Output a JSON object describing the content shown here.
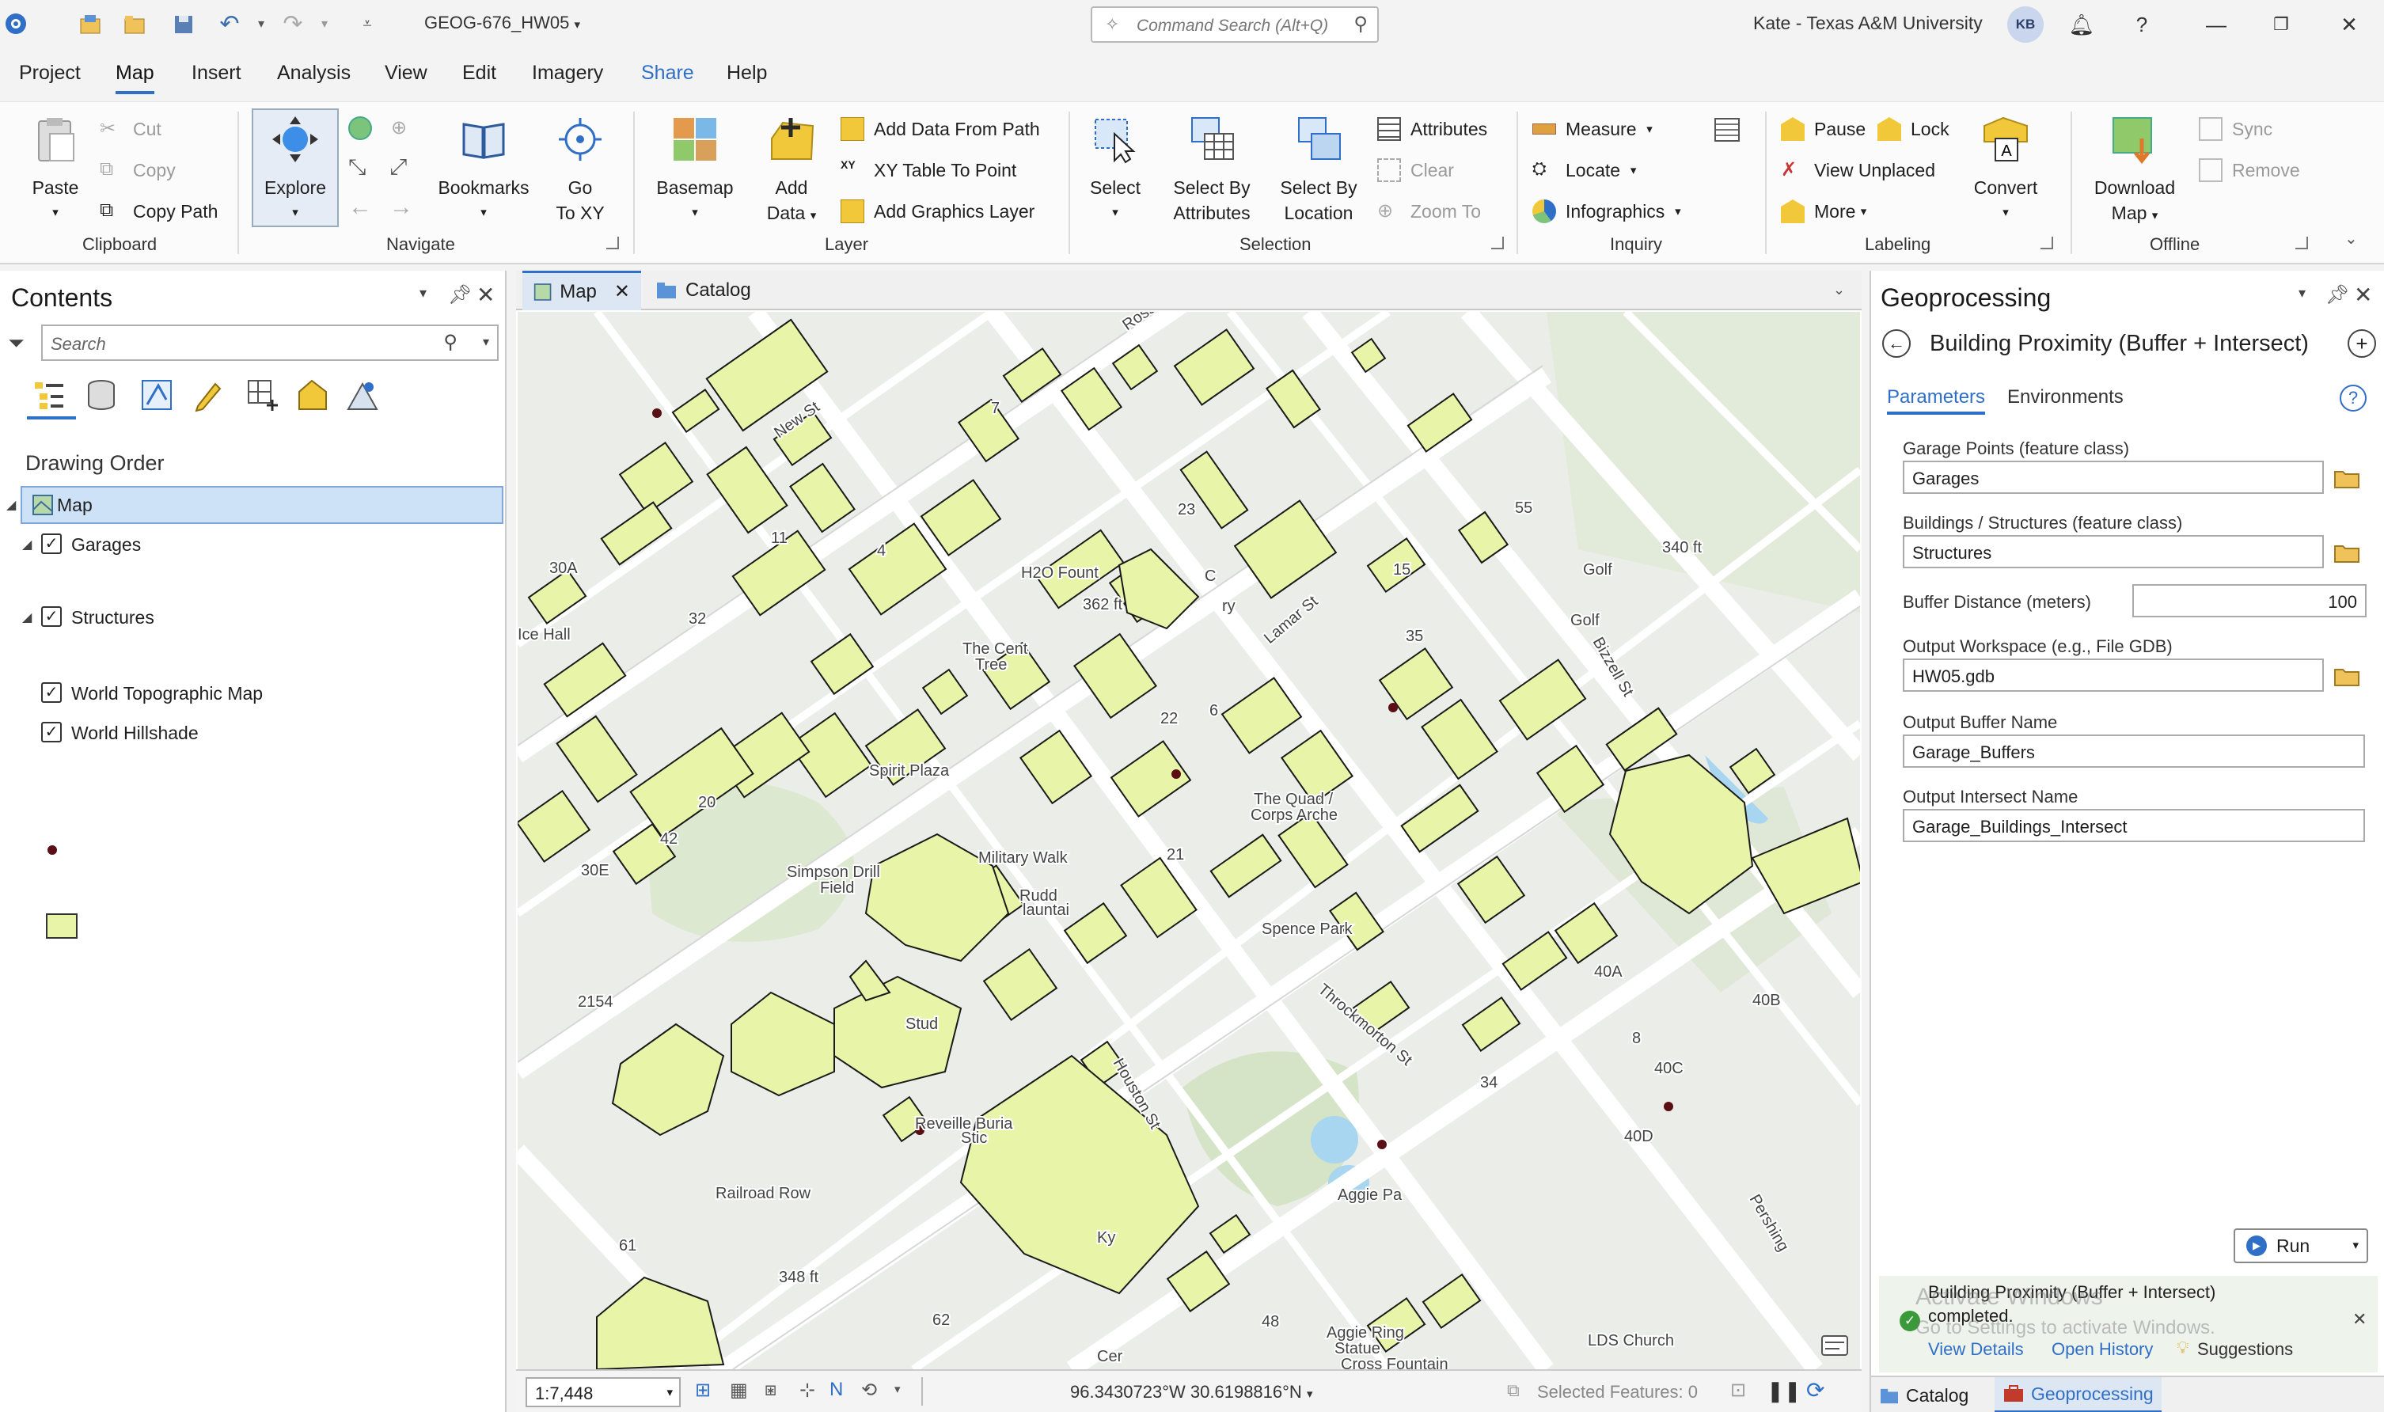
{
  "titlebar": {
    "project_title": "GEOG-676_HW05",
    "search_placeholder": "Command Search (Alt+Q)",
    "user": "Kate - Texas A&M University",
    "initials": "KB",
    "help": "?"
  },
  "menu": {
    "tabs": [
      "Project",
      "Map",
      "Insert",
      "Analysis",
      "View",
      "Edit",
      "Imagery",
      "Share",
      "Help"
    ],
    "active": "Map"
  },
  "ribbon": {
    "clipboard": {
      "label": "Clipboard",
      "paste": "Paste",
      "cut": "Cut",
      "copy": "Copy",
      "copy_path": "Copy Path"
    },
    "navigate": {
      "label": "Navigate",
      "explore": "Explore",
      "bookmarks": "Bookmarks",
      "go_to_xy_1": "Go",
      "go_to_xy_2": "To XY"
    },
    "layer": {
      "label": "Layer",
      "basemap": "Basemap",
      "add_data_1": "Add",
      "add_data_2": "Data",
      "add_from_path": "Add Data From Path",
      "xy_table": "XY Table To Point",
      "add_graphics": "Add Graphics Layer"
    },
    "selection": {
      "label": "Selection",
      "select": "Select",
      "by_attr_1": "Select By",
      "by_attr_2": "Attributes",
      "by_loc_1": "Select By",
      "by_loc_2": "Location",
      "attributes": "Attributes",
      "clear": "Clear",
      "zoom_to": "Zoom To"
    },
    "inquiry": {
      "label": "Inquiry",
      "measure": "Measure",
      "locate": "Locate",
      "infographics": "Infographics"
    },
    "labeling": {
      "label": "Labeling",
      "pause": "Pause",
      "lock": "Lock",
      "view_unplaced": "View Unplaced",
      "more": "More",
      "convert": "Convert"
    },
    "offline": {
      "label": "Offline",
      "download_1": "Download",
      "download_2": "Map",
      "sync": "Sync",
      "remove": "Remove"
    }
  },
  "contents": {
    "title": "Contents",
    "search_placeholder": "Search",
    "drawing_order": "Drawing Order",
    "map": "Map",
    "layers": [
      {
        "name": "Garages",
        "checked": true
      },
      {
        "name": "Structures",
        "checked": true
      },
      {
        "name": "World Topographic Map",
        "checked": true
      },
      {
        "name": "World Hillshade",
        "checked": true
      }
    ]
  },
  "mapview": {
    "tabs": [
      "Map",
      "Catalog"
    ],
    "scale": "1:7,448",
    "coordinates": "96.3430723°W 30.6198816°N",
    "selected_features": "Selected Features: 0",
    "labels": [
      "New St",
      "H2O Fount",
      "11",
      "4",
      "23",
      "30A",
      "55",
      "15",
      "340 ft",
      "32",
      "362 ft",
      "C",
      "Golf",
      "ry",
      "35",
      "Lamar St",
      "The Cent",
      "Tree",
      "6",
      "22",
      "Bizzell St",
      "Spirit Plaza",
      "20",
      "The Quad /",
      "Corps Arche",
      "42",
      "Military Walk",
      "21",
      "30E",
      "Simpson Drill",
      "Field",
      "Rudd",
      "launtai",
      "Spence Park",
      "40A",
      "40B",
      "2154",
      "Stud",
      "Throckmorton St",
      "8",
      "34",
      "40C",
      "40D",
      "Houston St",
      "Reveille Buria",
      "Stic",
      "Railroad Row",
      "Aggie Pa",
      "61",
      "Ky",
      "Pershing",
      "348 ft",
      "62",
      "48",
      "Aggie Ring",
      "Statue",
      "LDS Church",
      "Cer",
      "Cross Fountain",
      "Ross St",
      "7",
      "a",
      "Ice Hall",
      "Golf"
    ]
  },
  "geoprocessing": {
    "title": "Geoprocessing",
    "tool_name": "Building Proximity (Buffer + Intersect)",
    "tab_parameters": "Parameters",
    "tab_environments": "Environments",
    "params": [
      {
        "label": "Garage Points (feature class)",
        "value": "Garages"
      },
      {
        "label": "Buildings / Structures (feature class)",
        "value": "Structures"
      },
      {
        "label": "Buffer Distance (meters)",
        "value": "100"
      },
      {
        "label": "Output Workspace (e.g., File GDB)",
        "value": "HW05.gdb"
      },
      {
        "label": "Output Buffer Name",
        "value": "Garage_Buffers"
      },
      {
        "label": "Output Intersect Name",
        "value": "Garage_Buildings_Intersect"
      }
    ],
    "run": "Run",
    "message_line1": "Building Proximity (Buffer + Intersect)",
    "message_line2": "completed.",
    "view_details": "View Details",
    "open_history": "Open History",
    "suggestions": "Suggestions",
    "watermark_1": "Activate Windows",
    "watermark_2": "Go to Settings to activate Windows.",
    "bottom_tabs": [
      "Catalog",
      "Geoprocessing"
    ]
  },
  "colors": {
    "accent": "#2f6fc7",
    "building_fill": "#e8f5a8",
    "map_bg": "#ebeee8",
    "road": "#ffffff",
    "garage_dot": "#5a0f14"
  }
}
